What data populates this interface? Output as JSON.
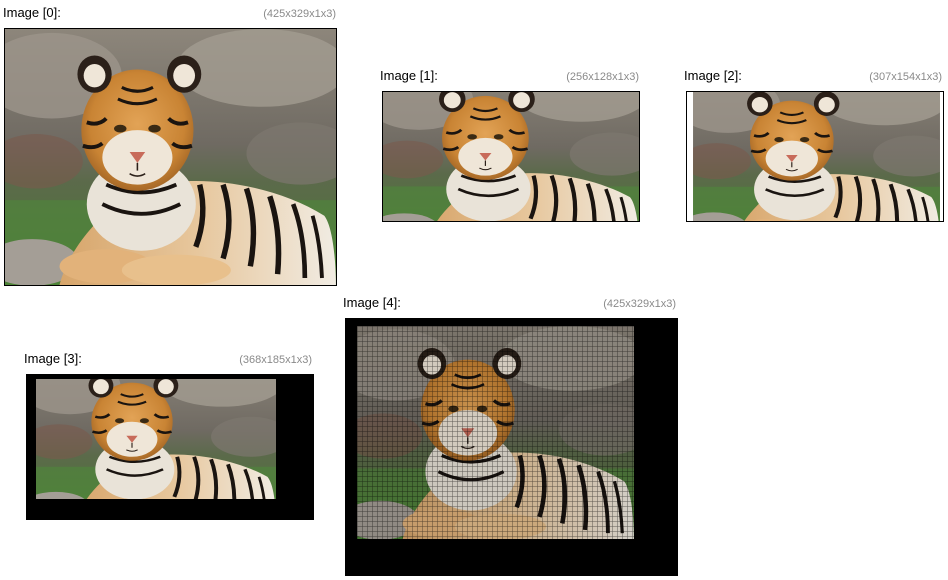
{
  "images": [
    {
      "label": "Image [0]:",
      "dims": "(425x329x1x3)"
    },
    {
      "label": "Image [1]:",
      "dims": "(256x128x1x3)"
    },
    {
      "label": "Image [2]:",
      "dims": "(307x154x1x3)"
    },
    {
      "label": "Image [3]:",
      "dims": "(368x185x1x3)"
    },
    {
      "label": "Image [4]:",
      "dims": "(425x329x1x3)"
    }
  ],
  "colors": {
    "background": "#ffffff",
    "label_text": "#000000",
    "dims_text": "#8a8a8a",
    "padding_fill": "#000000",
    "tiger_orange": "#d48a3c",
    "rock_grey": "#8b8378",
    "grass_green": "#4f8a3a"
  }
}
